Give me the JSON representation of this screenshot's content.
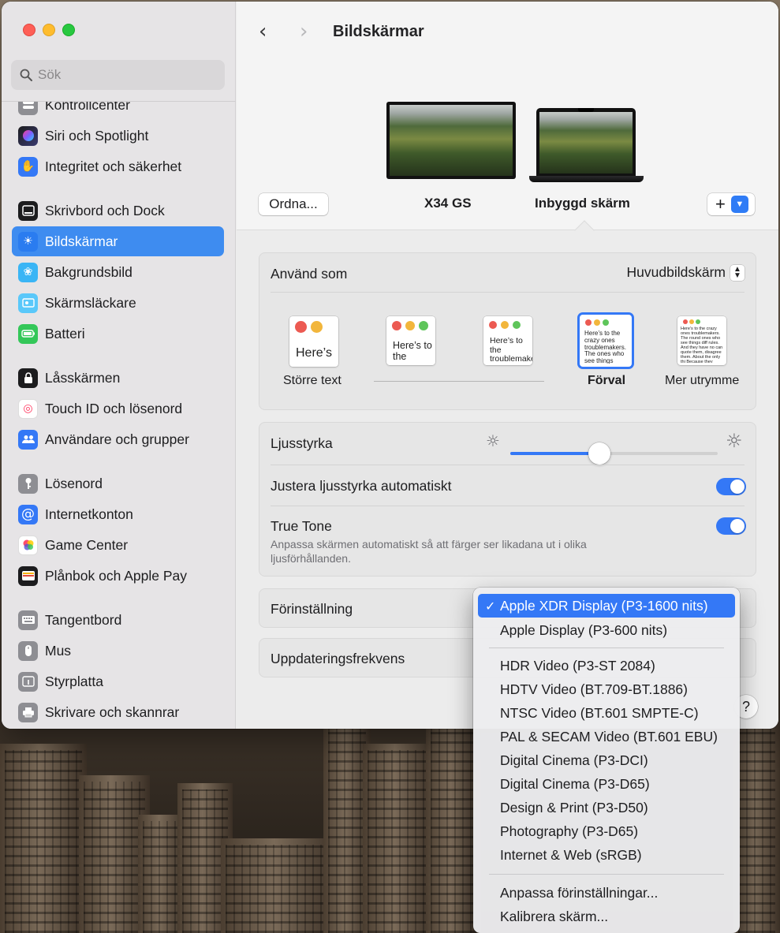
{
  "window": {
    "title": "Bildskärmar"
  },
  "search": {
    "placeholder": "Sök"
  },
  "sidebar": {
    "items": [
      {
        "label": "Kontrollcenter",
        "icon": "control-center-icon"
      },
      {
        "label": "Siri och Spotlight",
        "icon": "siri-icon"
      },
      {
        "label": "Integritet och säkerhet",
        "icon": "hand-icon"
      },
      {
        "label": "Skrivbord och Dock",
        "icon": "dock-icon"
      },
      {
        "label": "Bildskärmar",
        "icon": "sun-icon",
        "active": true
      },
      {
        "label": "Bakgrundsbild",
        "icon": "wallpaper-icon"
      },
      {
        "label": "Skärmsläckare",
        "icon": "screensaver-icon"
      },
      {
        "label": "Batteri",
        "icon": "battery-icon"
      },
      {
        "label": "Låsskärmen",
        "icon": "lock-icon"
      },
      {
        "label": "Touch ID och lösenord",
        "icon": "fingerprint-icon"
      },
      {
        "label": "Användare och grupper",
        "icon": "users-icon"
      },
      {
        "label": "Lösenord",
        "icon": "key-icon"
      },
      {
        "label": "Internetkonton",
        "icon": "at-icon"
      },
      {
        "label": "Game Center",
        "icon": "game-center-icon"
      },
      {
        "label": "Plånbok och Apple Pay",
        "icon": "wallet-icon"
      },
      {
        "label": "Tangentbord",
        "icon": "keyboard-icon"
      },
      {
        "label": "Mus",
        "icon": "mouse-icon"
      },
      {
        "label": "Styrplatta",
        "icon": "trackpad-icon"
      },
      {
        "label": "Skrivare och skannrar",
        "icon": "printer-icon"
      }
    ]
  },
  "displays": {
    "arrange_label": "Ordna...",
    "external_name": "X34 GS",
    "builtin_name": "Inbyggd skärm",
    "add_label": "+"
  },
  "use_as": {
    "label": "Använd som",
    "value": "Huvudbildskärm",
    "options": [
      {
        "label": "Större text",
        "sample": "Here’s"
      },
      {
        "label": "",
        "sample": "Here’s to the troublemakers"
      },
      {
        "label": "",
        "sample": "Here’s to the troublemakers. The ones who"
      },
      {
        "label": "Förval",
        "sample": "Here’s to the crazy ones troublemakers. The ones who see things rules. And they",
        "selected": true
      },
      {
        "label": "Mer utrymme",
        "sample": "Here’s to the crazy ones troublemakers. The round ones who see things diff rules. And they have no can quote them, disagree them. About the only thi Because they change th"
      }
    ]
  },
  "brightness": {
    "label": "Ljusstyrka",
    "level": 0.43
  },
  "auto_brightness": {
    "label": "Justera ljusstyrka automatiskt",
    "on": true
  },
  "true_tone": {
    "label": "True Tone",
    "description": "Anpassa skärmen automatiskt så att färger ser likadana ut i olika ljusförhållanden.",
    "on": true
  },
  "preset": {
    "label": "Förinställning"
  },
  "refresh": {
    "label": "Uppdateringsfrekvens"
  },
  "help_label": "?",
  "menu": {
    "items": [
      {
        "label": "Apple XDR Display (P3-1600 nits)",
        "checked": true
      },
      {
        "label": "Apple Display (P3-600 nits)"
      },
      {
        "label": "HDR Video (P3-ST 2084)"
      },
      {
        "label": "HDTV Video (BT.709-BT.1886)"
      },
      {
        "label": "NTSC Video (BT.601 SMPTE-C)"
      },
      {
        "label": "PAL & SECAM Video (BT.601 EBU)"
      },
      {
        "label": "Digital Cinema (P3-DCI)"
      },
      {
        "label": "Digital Cinema (P3-D65)"
      },
      {
        "label": "Design & Print (P3-D50)"
      },
      {
        "label": "Photography (P3-D65)"
      },
      {
        "label": "Internet & Web (sRGB)"
      },
      {
        "label": "Anpassa förinställningar..."
      },
      {
        "label": "Kalibrera skärm..."
      }
    ]
  },
  "colors": {
    "accent": "#3478f6",
    "sidebar_active": "#3e8cf0"
  }
}
